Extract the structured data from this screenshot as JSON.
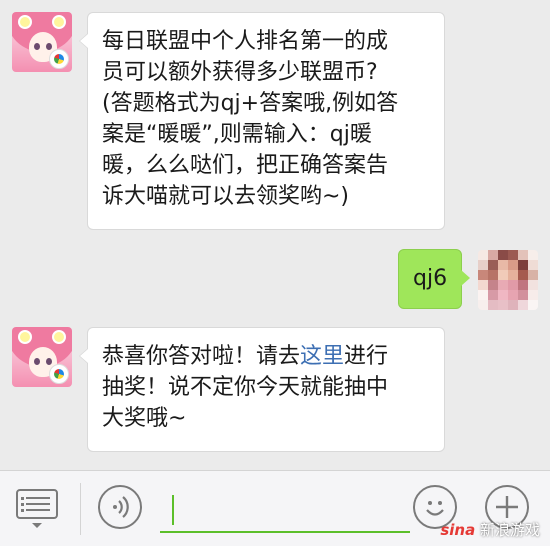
{
  "messages": [
    {
      "sender": "bot",
      "lines": [
        "每日联盟中个人排名第一的成",
        "员可以额外获得多少联盟币?",
        "(答题格式为qj+答案哦,例如答",
        "案是“暖暖”,则需输入：qj暖",
        "暖，么么哒们，把正确答案告",
        "诉大喵就可以去领奖哟~)"
      ]
    },
    {
      "sender": "user",
      "text": "qj6"
    },
    {
      "sender": "bot",
      "line1_before": "恭喜你答对啦！请去",
      "line1_link": "这里",
      "line1_after": "进行",
      "line2": "抽奖！说不定你今天就能抽中",
      "line3": "大奖哦~"
    }
  ],
  "input": {
    "value": "",
    "placeholder": ""
  },
  "watermark": {
    "sina": "sina",
    "text": "新浪游戏"
  },
  "colors": {
    "background": "#ebebeb",
    "user_bubble": "#9fe65a",
    "link": "#3d6fb3",
    "input_underline": "#5cbf2a"
  }
}
